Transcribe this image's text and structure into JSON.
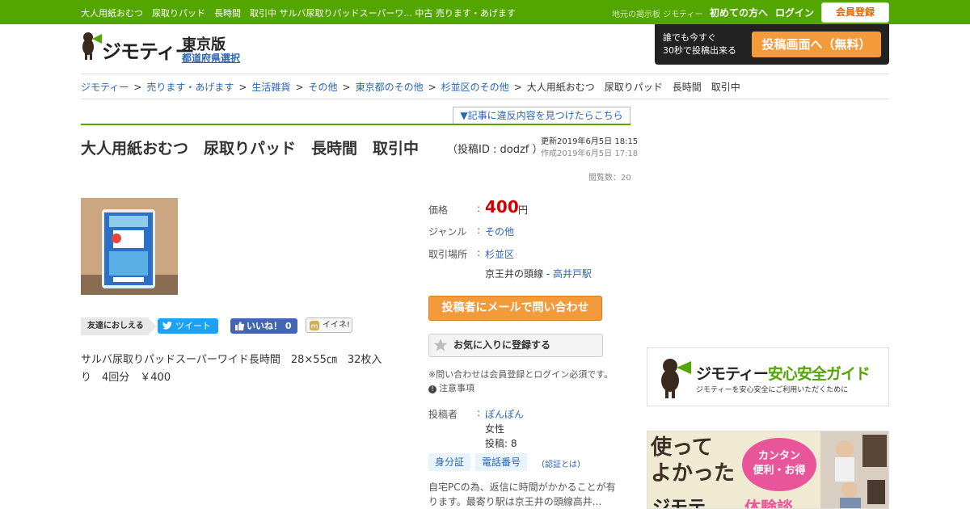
{
  "topbar": {
    "page_title": "大人用紙おむつ　尿取りパッド　長時間　取引中 サルバ尿取りパッドスーパーワ... 中古 売ります・あげます",
    "tagline": "地元の掲示板 ジモティー",
    "first_time": "初めての方へ",
    "login": "ログイン",
    "register": "会員登録"
  },
  "header": {
    "logo_text": "ジモティー",
    "edition": "東京版",
    "pref_select": "都道府県選択",
    "post_banner_text_1": "誰でも今すぐ",
    "post_banner_text_2": "30秒で投稿出来る",
    "post_banner_button": "投稿画面へ（無料）"
  },
  "breadcrumb": {
    "items": [
      "ジモティー",
      "売ります・あげます",
      "生活雑貨",
      "その他",
      "東京都のその他",
      "杉並区のその他"
    ],
    "separator": ">",
    "current": "大人用紙おむつ　尿取りパッド　長時間　取引中"
  },
  "report_link": "▼記事に違反内容を見つけたらこちら",
  "article": {
    "title": "大人用紙おむつ　尿取りパッド　長時間　取引中",
    "post_id": "（投稿ID : dodzf ）",
    "updated": "更新2019年6月5日 18:15",
    "created": "作成2019年6月5日 17:18",
    "views": "閲覧数：20",
    "description": "サルバ尿取りパッドスーパーワイド長時間　28×55㎝　32枚入り　4回分　￥400"
  },
  "share": {
    "label": "友達におしえる",
    "tweet": "ツイート",
    "like": "いいね！ 0",
    "iine": "イイネ!"
  },
  "details": {
    "price_label": "価格",
    "price": "400",
    "price_unit": "円",
    "genre_label": "ジャンル",
    "genre": "その他",
    "place_label": "取引場所",
    "place": "杉並区",
    "station_prefix": "京王井の頭線 - ",
    "station": "高井戸駅",
    "colon": ":"
  },
  "actions": {
    "mail": "投稿者にメールで問い合わせ",
    "favorite": "お気に入りに登録する",
    "note1": "※問い合わせは会員登録とログイン必須です。",
    "note2": "注意事項"
  },
  "poster": {
    "label": "投稿者",
    "name": "ぽんぽん",
    "gender": "女性",
    "count": "投稿: 8",
    "badge_id": "身分証",
    "badge_phone": "電話番号",
    "auth_open": "（",
    "auth_what": "認証とは",
    "auth_close": "）",
    "comment": "自宅PCの為、返信に時間がかかることが有ります。最寄り駅は京王井の頭線高井..."
  },
  "side": {
    "safety_title_brand": "ジモティー",
    "safety_title": "安心安全ガイド",
    "safety_sub": "ジモティーを安心安全にご利用いただくために",
    "exp_title_1": "使って",
    "exp_title_2": "よかった",
    "exp_bubble_1": "カンタン",
    "exp_bubble_2": "便利・お得",
    "exp_brand": "ジモテ",
    "exp_tail": "体験談"
  },
  "colors": {
    "brand_green": "#53a500",
    "accent_orange": "#f39a3a",
    "price_red": "#d40000",
    "link_blue": "#2a65b5"
  }
}
